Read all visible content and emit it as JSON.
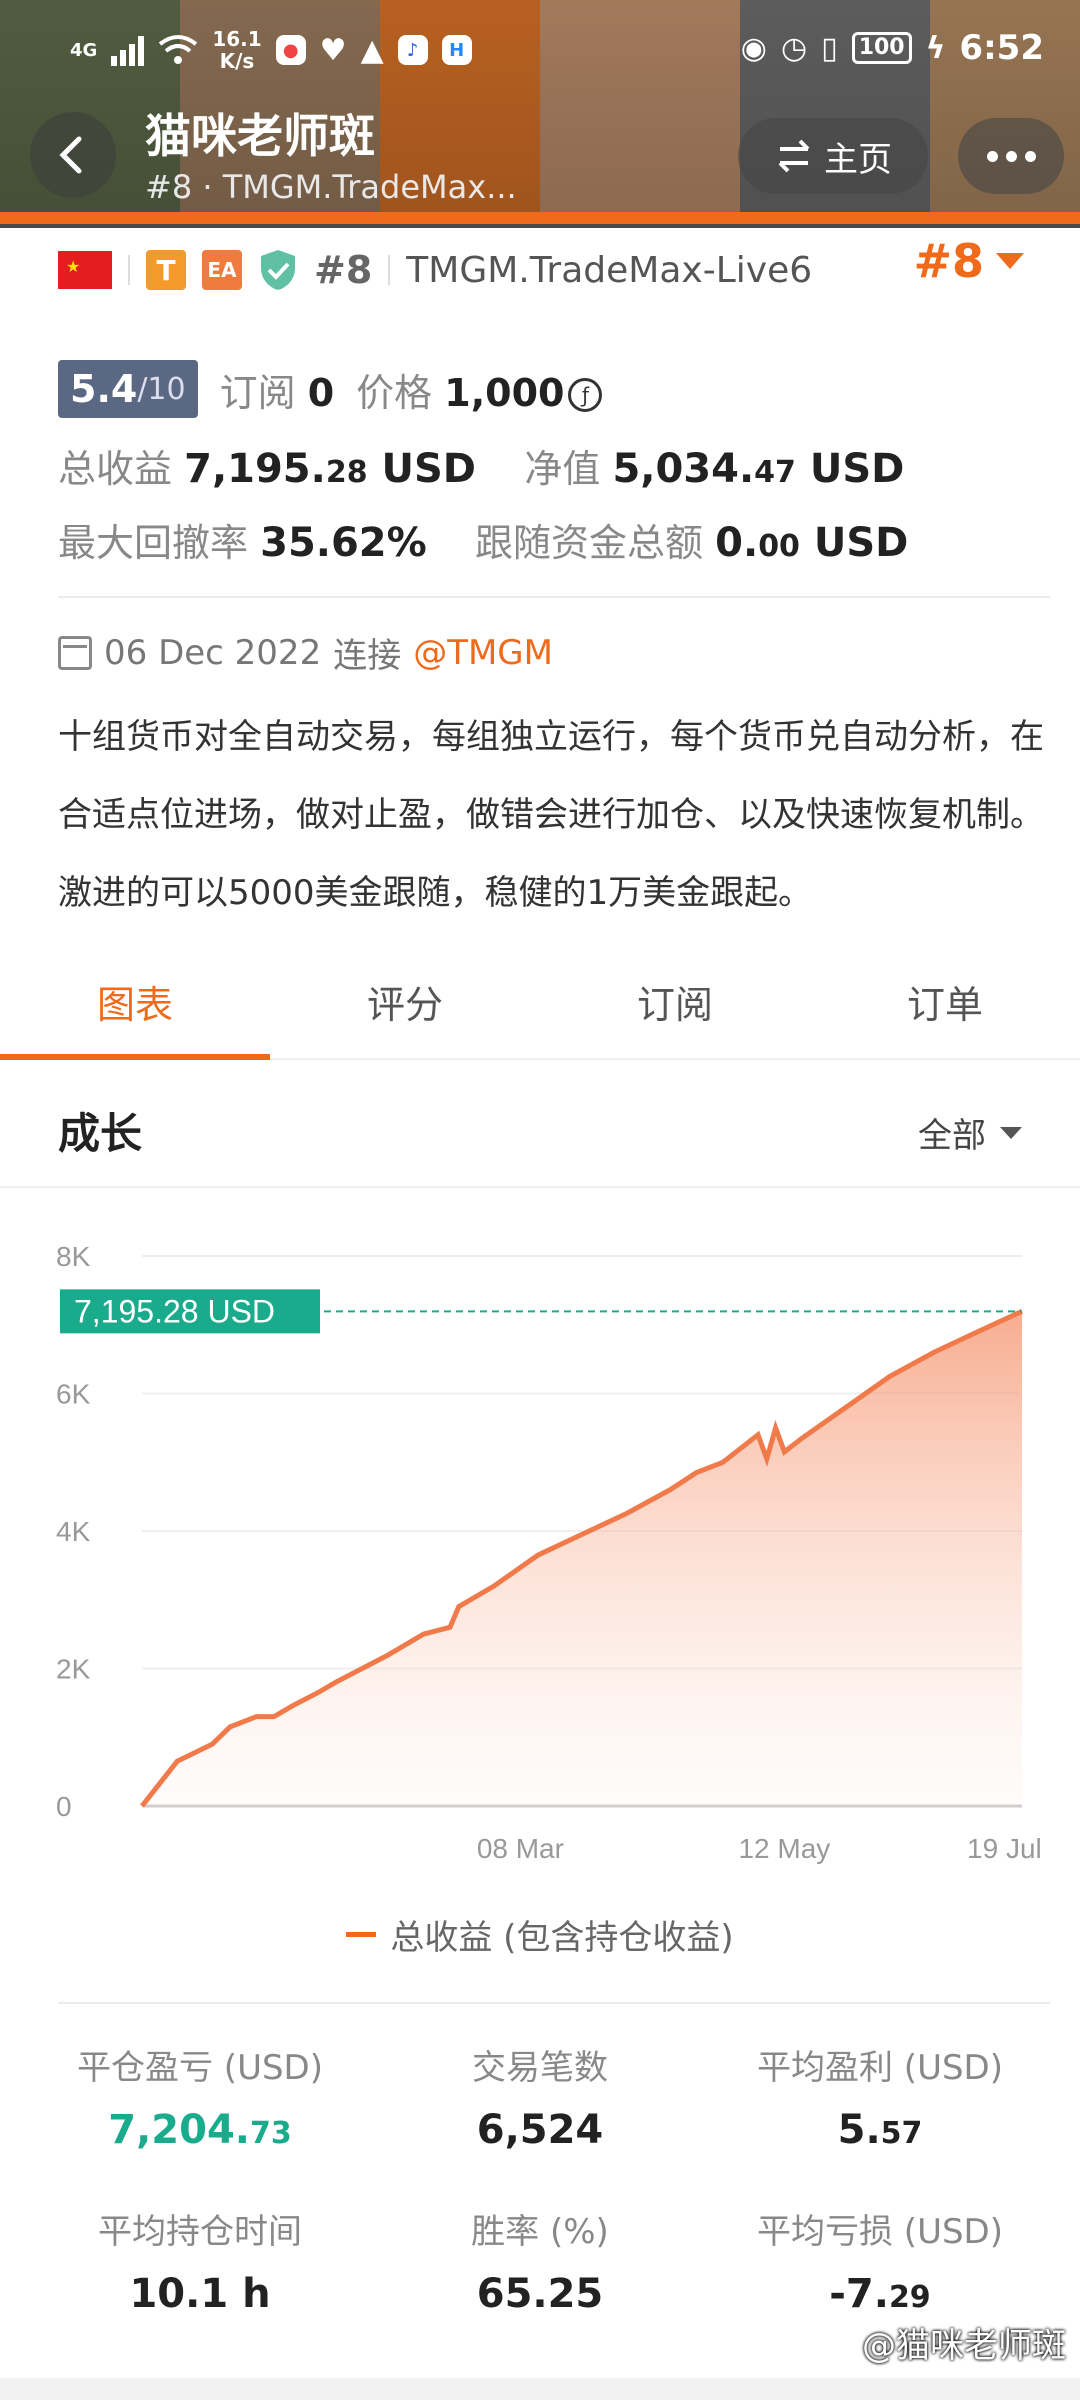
{
  "status_bar": {
    "network": "4G",
    "speed_top": "16.1",
    "speed_bottom": "K/s",
    "battery": "100",
    "time": "6:52"
  },
  "header": {
    "title": "猫咪老师斑",
    "subtitle": "#8 · TMGM.TradeMax...",
    "home_label": "主页",
    "photo_colors": [
      "#6b7a55",
      "#b08c6a",
      "#f5812c",
      "#d8a27a",
      "#7b7b7b",
      "#c79b6e"
    ]
  },
  "info_row": {
    "badge_t": "T",
    "badge_ea": "EA",
    "rank": "#8",
    "server": "TMGM.TradeMax-Live6",
    "rank_right": "#8"
  },
  "score": {
    "value": "5.4",
    "max": "/10",
    "subscribe_label": "订阅",
    "subscribe_value": "0",
    "price_label": "价格",
    "price_value": "1,000"
  },
  "stats": {
    "total_profit_label": "总收益",
    "total_profit_int": "7,195.",
    "total_profit_dec": "28",
    "total_profit_unit": " USD",
    "equity_label": "净值",
    "equity_int": "5,034.",
    "equity_dec": "47",
    "equity_unit": " USD",
    "drawdown_label": "最大回撤率",
    "drawdown_value": "35.62%",
    "follow_label": "跟随资金总额",
    "follow_int": "0.",
    "follow_dec": "00",
    "follow_unit": " USD"
  },
  "connection": {
    "date": "06 Dec 2022",
    "label": "连接",
    "broker": "@TMGM"
  },
  "description": "十组货币对全自动交易，每组独立运行，每个货币兑自动分析，在合适点位进场，做对止盈，做错会进行加仓、以及快速恢复机制。 激进的可以5000美金跟随，稳健的1万美金跟起。",
  "tabs": [
    "图表",
    "评分",
    "订阅",
    "订单"
  ],
  "section": {
    "title": "成长",
    "filter": "全部"
  },
  "chart_data": {
    "type": "area",
    "series": [
      {
        "name": "总收益 (包含持仓收益)",
        "color": "#f07a4a",
        "x": [
          0,
          0.04,
          0.08,
          0.1,
          0.13,
          0.15,
          0.17,
          0.2,
          0.22,
          0.28,
          0.32,
          0.35,
          0.36,
          0.4,
          0.45,
          0.5,
          0.55,
          0.6,
          0.63,
          0.66,
          0.7,
          0.71,
          0.72,
          0.73,
          0.75,
          0.8,
          0.85,
          0.9,
          0.95,
          1.0
        ],
        "values": [
          0,
          650,
          900,
          1150,
          1300,
          1300,
          1450,
          1650,
          1800,
          2200,
          2500,
          2600,
          2900,
          3200,
          3650,
          3950,
          4250,
          4600,
          4850,
          5000,
          5400,
          5050,
          5500,
          5150,
          5350,
          5800,
          6250,
          6600,
          6900,
          7195.28
        ]
      }
    ],
    "x_ticks": [
      "08 Mar",
      "12 May",
      "19 Jul"
    ],
    "y_ticks": [
      "0",
      "2K",
      "4K",
      "6K",
      "8K"
    ],
    "ylim": [
      0,
      8000
    ],
    "last_value_label": "7,195.28 USD"
  },
  "legend_label": "总收益 (包含持仓收益)",
  "summary": [
    {
      "label": "平仓盈亏 (USD)",
      "int": "7,204.",
      "dec": "73",
      "green": true
    },
    {
      "label": "交易笔数",
      "int": "6,524",
      "dec": "",
      "green": false
    },
    {
      "label": "平均盈利 (USD)",
      "int": "5.",
      "dec": "57",
      "green": false
    },
    {
      "label": "平均持仓时间",
      "int": "10.1 h",
      "dec": "",
      "green": false
    },
    {
      "label": "胜率 (%)",
      "int": "65.25",
      "dec": "",
      "green": false
    },
    {
      "label": "平均亏损 (USD)",
      "int": "-7.",
      "dec": "29",
      "green": false
    }
  ],
  "watermark": "@猫咪老师斑"
}
